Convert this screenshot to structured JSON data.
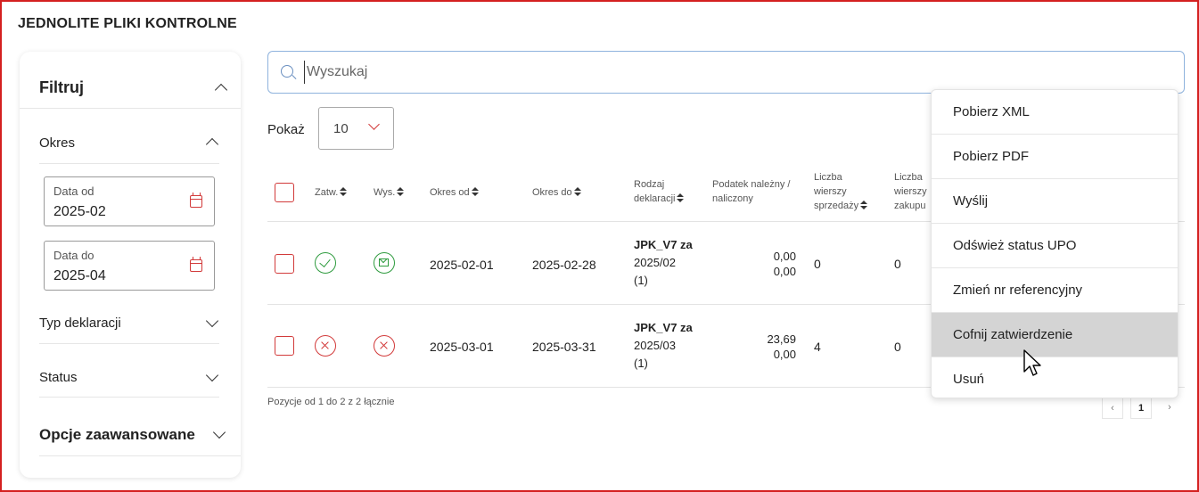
{
  "page": {
    "title": "JEDNOLITE PLIKI KONTROLNE"
  },
  "sidebar": {
    "header": "Filtruj",
    "okres": {
      "label": "Okres",
      "date_from": {
        "label": "Data od",
        "value": "2025-02"
      },
      "date_to": {
        "label": "Data do",
        "value": "2025-04"
      }
    },
    "typ": "Typ deklaracji",
    "status": "Status",
    "advanced": "Opcje zaawansowane"
  },
  "search": {
    "placeholder": "Wyszukaj",
    "value": ""
  },
  "page_size": {
    "label": "Pokaż",
    "value": "10"
  },
  "table": {
    "headers": {
      "zatw": "Zatw.",
      "wys": "Wys.",
      "okres_od": "Okres od",
      "okres_do": "Okres do",
      "rodzaj_1": "Rodzaj",
      "rodzaj_2": "deklaracji",
      "podatek_1": "Podatek należny /",
      "podatek_2": "naliczony",
      "sprzedaz_1": "Liczba",
      "sprzedaz_2": "wierszy",
      "sprzedaz_3": "sprzedaży",
      "zakup_1": "Liczba",
      "zakup_2": "wierszy",
      "zakup_3": "zakupu"
    },
    "rows": [
      {
        "zatw": "approved",
        "wys": "sent",
        "okres_od": "2025-02-01",
        "okres_do": "2025-02-28",
        "decl_1": "JPK_V7 za",
        "decl_2": "2025/02",
        "decl_3": "(1)",
        "tax_due": "0,00",
        "tax_input": "0,00",
        "sales_rows": "0",
        "purchase_rows": "0"
      },
      {
        "zatw": "not-approved",
        "wys": "not-sent",
        "okres_od": "2025-03-01",
        "okres_do": "2025-03-31",
        "decl_1": "JPK_V7 za",
        "decl_2": "2025/03",
        "decl_3": "(1)",
        "tax_due": "23,69",
        "tax_input": "0,00",
        "sales_rows": "4",
        "purchase_rows": "0"
      }
    ],
    "footer": "Pozycje od 1 do 2 z 2 łącznie",
    "pagination": {
      "prev": "‹",
      "current": "1",
      "next": "›"
    }
  },
  "context_menu": {
    "items": [
      "Pobierz XML",
      "Pobierz PDF",
      "Wyślij",
      "Odśwież status UPO",
      "Zmień nr referencyjny",
      "Cofnij zatwierdzenie",
      "Usuń"
    ],
    "hovered_index": 5
  },
  "colors": {
    "accent": "#d23a3a",
    "success": "#2e9b3e",
    "frame": "#d42020",
    "hover": "#d4d4d4"
  }
}
